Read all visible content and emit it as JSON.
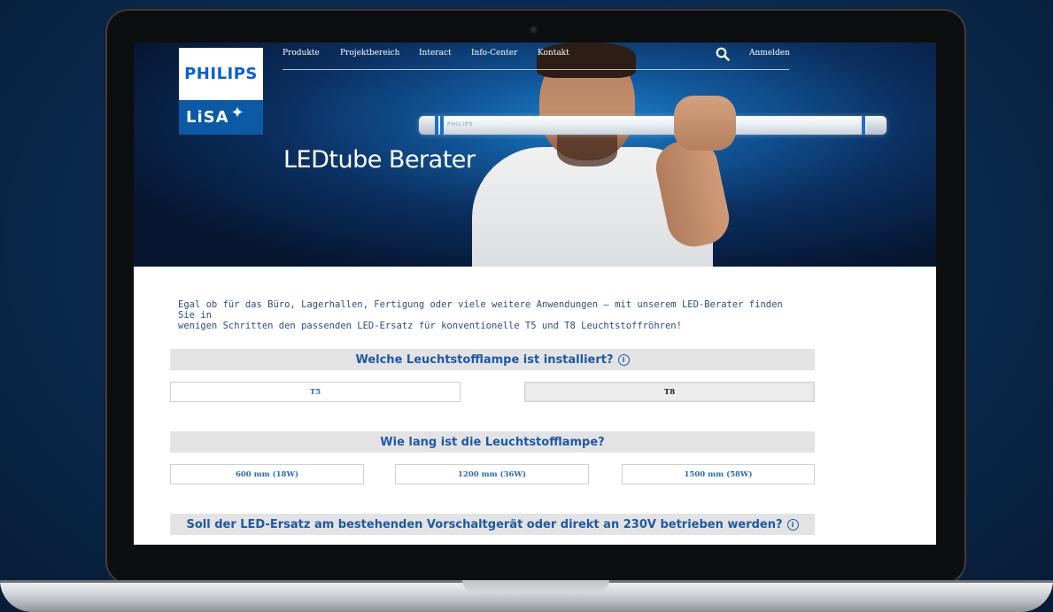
{
  "nav": {
    "items": [
      "Produkte",
      "Projektbereich",
      "Interact",
      "Info-Center",
      "Kontakt"
    ],
    "login": "Anmelden"
  },
  "logo": {
    "brand": "PHILIPS",
    "product": "LiSA"
  },
  "hero": {
    "title": "LEDtube Berater",
    "tube_brand": "PHILIPS"
  },
  "intro": {
    "line1": "Egal ob für das Büro, Lagerhallen, Fertigung oder viele weitere Anwendungen – mit unserem LED-Berater finden Sie in",
    "line2": "wenigen Schritten den passenden LED-Ersatz für konventionelle T5 und T8 Leuchtstoffröhren!"
  },
  "questions": {
    "q1": {
      "label": "Welche Leuchtstofflampe ist installiert?",
      "options": [
        "T5",
        "T8"
      ],
      "selected": "T8"
    },
    "q2": {
      "label": "Wie lang ist die Leuchtstofflampe?",
      "options": [
        "600 mm (18W)",
        "1200 mm (36W)",
        "1500 mm (58W)"
      ]
    },
    "q3": {
      "label": "Soll der LED-Ersatz am bestehenden Vorschaltgerät oder direkt an 230V betrieben werden?"
    }
  },
  "icons": {
    "info": "ⓘ"
  },
  "colors": {
    "brand_blue": "#0b5ed7",
    "question_text": "#1c5aa6",
    "option_text": "#2c6cb0",
    "question_bar": "#e3e3e3"
  }
}
